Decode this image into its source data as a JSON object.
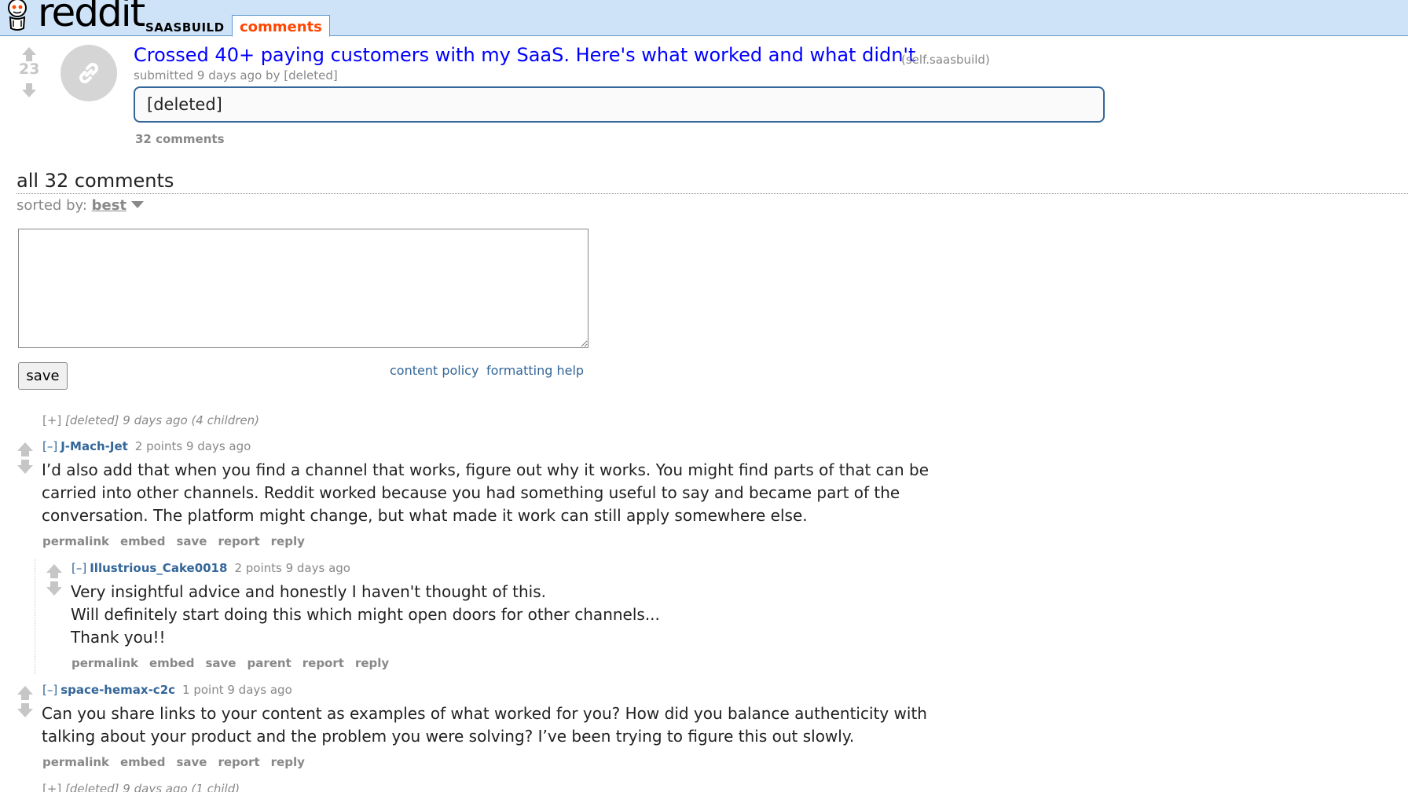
{
  "header": {
    "logo_text": "reddit",
    "subreddit": "SAASBUILD",
    "active_tab": "comments"
  },
  "post": {
    "score": "23",
    "title": "Crossed 40+ paying customers with my SaaS. Here's what worked and what didn't",
    "domain": "(self.saasbuild)",
    "tagline": "submitted 9 days ago by [deleted]",
    "body": "[deleted]",
    "comments_link": "32 comments"
  },
  "comment_area": {
    "heading": "all 32 comments",
    "sort_label": "sorted by: ",
    "sort_value": "best",
    "reply_box_value": "",
    "save_label": "save",
    "content_policy": "content policy",
    "formatting_help": "formatting help"
  },
  "comments": {
    "collapsed_1": {
      "toggle": "[+]",
      "text": " [deleted] 9 days ago (4 children)"
    },
    "c1": {
      "toggle": "[–]",
      "author": "J-Mach-Jet",
      "meta": "2 points 9 days ago",
      "lines": [
        "I’d also add that when you find a channel that works, figure out why it works. You might find parts of that can be",
        "carried into other channels. Reddit worked because you had something useful to say and became part of the",
        "conversation. The platform might change, but what made it work can still apply somewhere else."
      ],
      "buttons": [
        "permalink",
        "embed",
        "save",
        "report",
        "reply"
      ]
    },
    "c2": {
      "toggle": "[–]",
      "author": "Illustrious_Cake0018",
      "meta": "2 points 9 days ago",
      "lines": [
        "Very insightful advice and honestly I haven't thought of this.",
        "Will definitely start doing this which might open doors for other channels...",
        "Thank you!!"
      ],
      "buttons": [
        "permalink",
        "embed",
        "save",
        "parent",
        "report",
        "reply"
      ]
    },
    "c3": {
      "toggle": "[–]",
      "author": "space-hemax-c2c",
      "meta": "1 point 9 days ago",
      "lines": [
        "Can you share links to your content as examples of what worked for you? How did you balance authenticity with",
        "talking about your product and the problem you were solving? I’ve been trying to figure this out slowly."
      ],
      "buttons": [
        "permalink",
        "embed",
        "save",
        "report",
        "reply"
      ]
    },
    "collapsed_2": {
      "toggle": "[+]",
      "text": " [deleted] 9 days ago (1 child)"
    }
  },
  "colors": {
    "header_bg": "#cee3f8",
    "title_link": "#0000ff",
    "author_link": "#369",
    "active_tab": "#ff4500",
    "muted": "#888"
  },
  "icons": {
    "logo": "reddit-alien-icon",
    "thumbnail": "link-icon",
    "upvote": "upvote-arrow-icon",
    "downvote": "downvote-arrow-icon",
    "sort": "caret-down-icon"
  }
}
